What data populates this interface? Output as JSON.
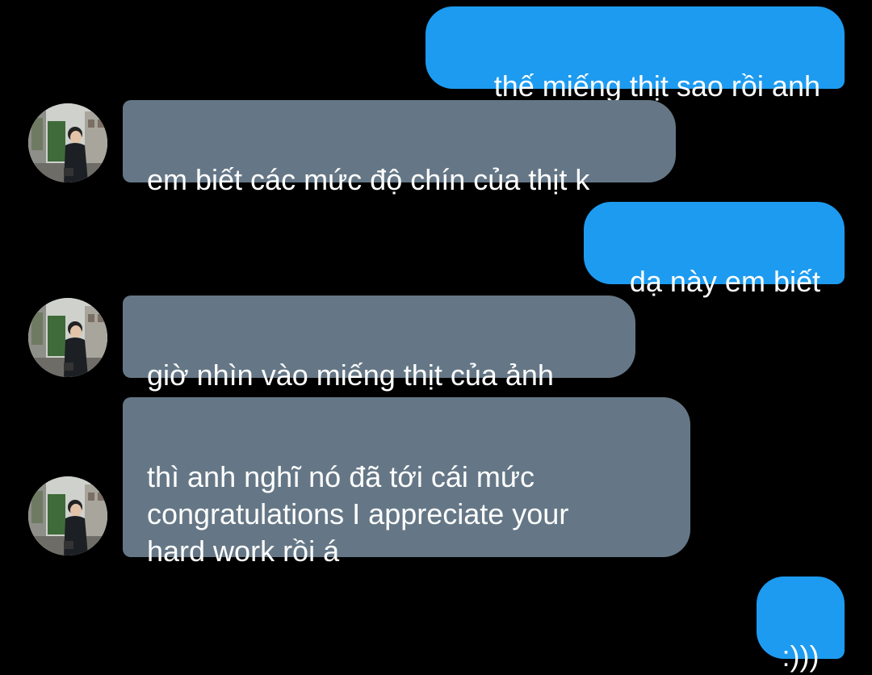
{
  "conversation": {
    "messages": [
      {
        "direction": "sent",
        "text": "thế miếng thịt sao rồi anh"
      },
      {
        "direction": "received",
        "text": "em biết các mức độ chín của thịt k",
        "sender_icon": "avatar-photo"
      },
      {
        "direction": "sent",
        "text": "dạ này em biết"
      },
      {
        "direction": "received",
        "text": "giờ nhìn vào miếng thịt của ảnh",
        "sender_icon": "avatar-photo"
      },
      {
        "direction": "received",
        "text": "thì anh nghĩ nó đã tới cái mức\ncongratulations I appreciate your\nhard work rồi á",
        "sender_icon": "avatar-photo"
      },
      {
        "direction": "sent",
        "text": ":)))"
      }
    ]
  },
  "colors": {
    "background": "#000000",
    "sent_bubble": "#1d9bf0",
    "received_bubble": "#657786",
    "text": "#ffffff"
  }
}
